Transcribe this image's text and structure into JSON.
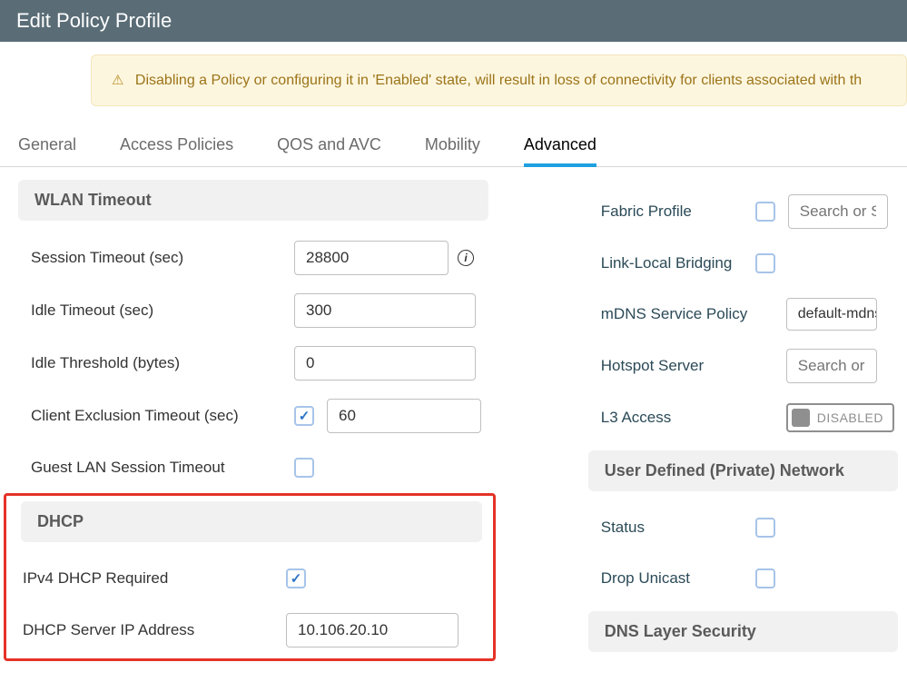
{
  "header": {
    "title": "Edit Policy Profile"
  },
  "alert": {
    "warn_symbol": "⚠",
    "text": "Disabling a Policy or configuring it in 'Enabled' state, will result in loss of connectivity for clients associated with th"
  },
  "tabs": {
    "general": "General",
    "access_policies": "Access Policies",
    "qos_avc": "QOS and AVC",
    "mobility": "Mobility",
    "advanced": "Advanced"
  },
  "left": {
    "wlan_timeout_title": "WLAN Timeout",
    "session_timeout_label": "Session Timeout (sec)",
    "session_timeout_value": "28800",
    "info_symbol": "i",
    "idle_timeout_label": "Idle Timeout (sec)",
    "idle_timeout_value": "300",
    "idle_threshold_label": "Idle Threshold (bytes)",
    "idle_threshold_value": "0",
    "client_exclusion_label": "Client Exclusion Timeout (sec)",
    "client_exclusion_check": "✓",
    "client_exclusion_value": "60",
    "guest_lan_label": "Guest LAN Session Timeout",
    "dhcp_title": "DHCP",
    "ipv4_dhcp_required_label": "IPv4 DHCP Required",
    "ipv4_dhcp_required_check": "✓",
    "dhcp_server_ip_label": "DHCP Server IP Address",
    "dhcp_server_ip_value": "10.106.20.10"
  },
  "right": {
    "fabric_profile_label": "Fabric Profile",
    "fabric_profile_placeholder": "Search or Sele",
    "link_local_bridging_label": "Link-Local Bridging",
    "mdns_label": "mDNS Service Policy",
    "mdns_value": "default-mdns-",
    "hotspot_label": "Hotspot Server",
    "hotspot_placeholder": "Search or Sele",
    "l3_access_label": "L3 Access",
    "l3_access_toggle": "DISABLED",
    "udn_title": "User Defined (Private) Network",
    "status_label": "Status",
    "drop_unicast_label": "Drop Unicast",
    "dns_layer_title": "DNS Layer Security"
  }
}
